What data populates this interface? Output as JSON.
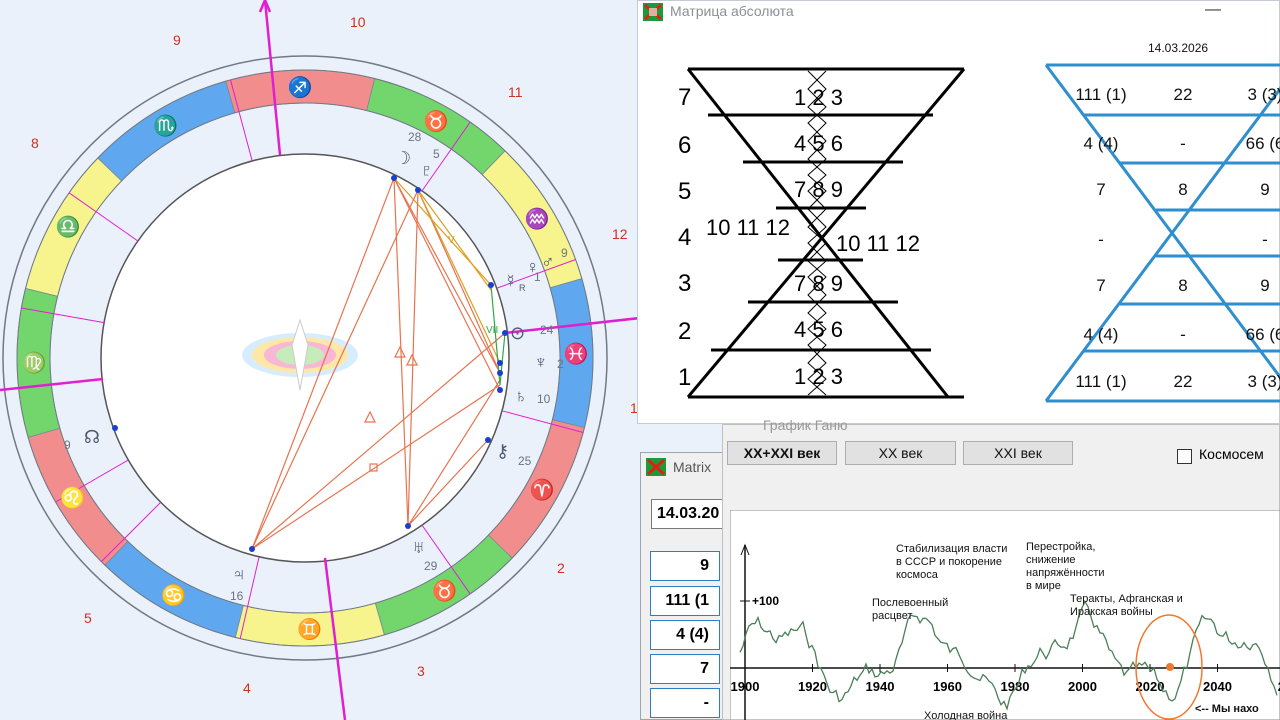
{
  "colors": {
    "fire": "#f28d8d",
    "earth": "#72d66d",
    "air": "#f8f48d",
    "water": "#5fa7ee",
    "pink": "#ff00ff",
    "blue_hourglass": "#2f8fce",
    "graph_line": "#4a7f56",
    "marker": "#f07830"
  },
  "chart_wheel": {
    "house_numbers": [
      "10",
      "11",
      "12",
      "1",
      "2",
      "3",
      "4",
      "5",
      "8",
      "9"
    ],
    "zodiac_glyphs": [
      "♐",
      "♉",
      "♒",
      "♓",
      "♈",
      "♉",
      "♊",
      "♋",
      "♌",
      "♍",
      "♎",
      "♏"
    ],
    "degrees": [
      "28",
      "5",
      "9",
      "1",
      "24",
      "2",
      "10",
      "25",
      "29",
      "16",
      "9"
    ],
    "planet_glyphs": [
      "☽",
      "♇",
      "♀",
      "☿",
      "♂",
      "⊙",
      "♆",
      "♃",
      "♅",
      "♄",
      "☊",
      "⚷"
    ],
    "retro": "R",
    "aspect_labels": [
      "V",
      "VII"
    ]
  },
  "matrix_window": {
    "title": "Матрица абсолюта",
    "date": "14.03.2026",
    "row_labels": [
      "7",
      "6",
      "5",
      "4",
      "3",
      "2",
      "1"
    ],
    "left": {
      "r7": "1 2 3",
      "r6": "4 5 6",
      "r5": "7 8 9",
      "r4_left": "10 11 12",
      "r4_right": "10 11 12",
      "r3": "7 8 9",
      "r2": "4 5 6",
      "r1": "1 2 3"
    },
    "right": {
      "rows": [
        [
          "111 (1)",
          "22",
          "3 (3)"
        ],
        [
          "4 (4)",
          "-",
          "66 (6"
        ],
        [
          "7",
          "8",
          "9"
        ],
        [
          "-",
          "",
          "-"
        ],
        [
          "7",
          "8",
          "9"
        ],
        [
          "4 (4)",
          "-",
          "66 (6"
        ],
        [
          "111 (1)",
          "22",
          "3 (3)"
        ]
      ]
    }
  },
  "matrix_small_window": {
    "title": "Matrix",
    "date_value": "14.03.20",
    "cells": [
      "9",
      "111 (1",
      "4 (4)",
      "7",
      "-"
    ]
  },
  "graph_window": {
    "title": "График Ганю",
    "buttons": [
      "XX+XXI век",
      "XX век",
      "XXI век"
    ],
    "checkbox_label": "Космосем",
    "y_label": "+100",
    "x_ticks": [
      "1900",
      "1920",
      "1940",
      "1960",
      "1980",
      "2000",
      "2020",
      "2040",
      "20"
    ],
    "annotations": {
      "a1": "Стабилизация власти",
      "a1b": "в СССР и покорение",
      "a1c": "космоса",
      "a2": "Послевоенный",
      "a2b": "расцвет",
      "a3": "Перестройка,",
      "a3b": "снижение",
      "a3c": "напряжённости",
      "a3d": "в мире",
      "a4": "Теракты, Афганская и",
      "a4b": "Иракская войны",
      "a5": "Холодная война",
      "a6": "<-- Мы нахо"
    }
  }
}
